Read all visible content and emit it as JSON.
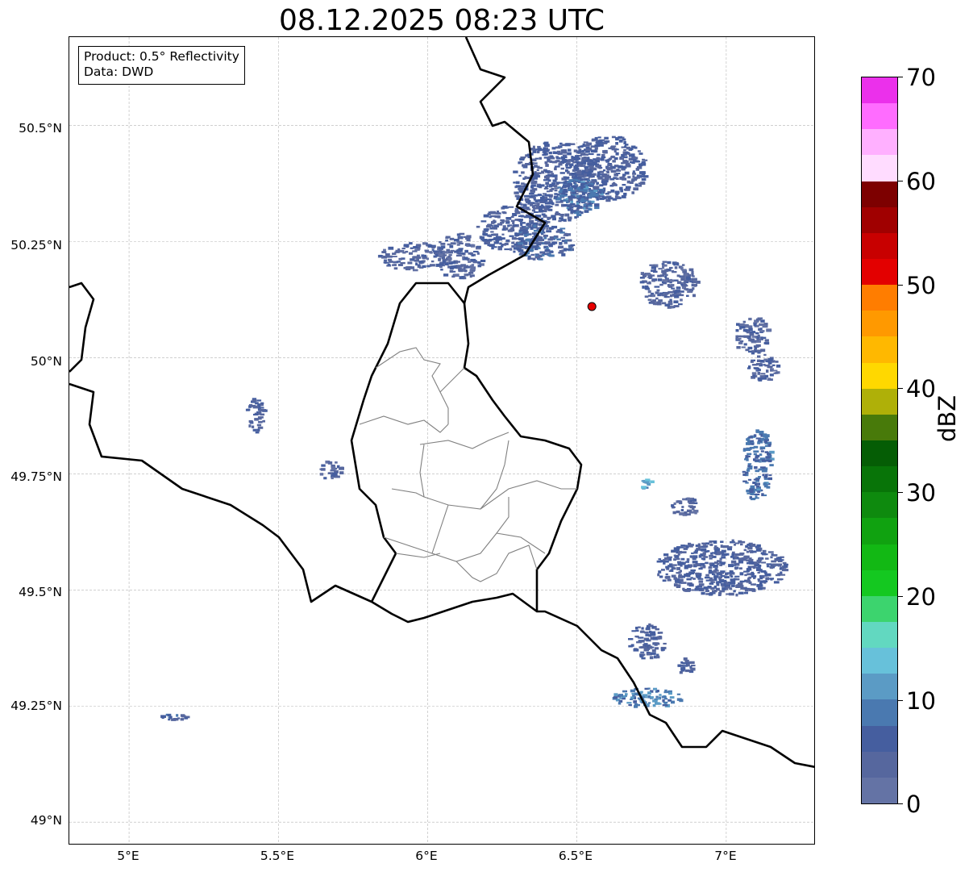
{
  "title": "08.12.2025 08:23 UTC",
  "info_box": {
    "product_line": "Product: 0.5° Reflectivity",
    "data_line": "Data: DWD"
  },
  "map": {
    "lon_range": [
      4.8,
      7.3
    ],
    "lat_range": [
      48.95,
      50.69
    ],
    "x_ticks": [
      "5°E",
      "5.5°E",
      "6°E",
      "6.5°E",
      "7°E"
    ],
    "y_ticks": [
      "50.5°N",
      "50.25°N",
      "50°N",
      "49.75°N",
      "49.5°N",
      "49.25°N",
      "49°N"
    ],
    "grid": true,
    "radar_site": {
      "lon": 6.55,
      "lat": 50.11,
      "color": "#e80000"
    },
    "border_color": "#000000",
    "district_color": "#808080"
  },
  "colorbar": {
    "label": "dBZ",
    "min": 0,
    "max": 70,
    "ticks": [
      "0",
      "10",
      "20",
      "30",
      "40",
      "50",
      "60",
      "70"
    ],
    "colors": [
      "#6473a5",
      "#56679e",
      "#455e9f",
      "#4a79b0",
      "#5b9bc5",
      "#67c1da",
      "#62d8c0",
      "#3cd46e",
      "#14c820",
      "#12b814",
      "#10a210",
      "#0e8a0e",
      "#087408",
      "#055d05",
      "#487a0a",
      "#afb008",
      "#ffd800",
      "#ffb800",
      "#ff9900",
      "#ff7d00",
      "#e30000",
      "#c80000",
      "#a00000",
      "#7d0000",
      "#ffdcff",
      "#ffb0ff",
      "#ff6cff",
      "#eb30eb"
    ]
  },
  "echoes": [
    {
      "lon": 6.42,
      "lat": 50.38,
      "rx": 0.14,
      "ry": 0.09,
      "dbz": 5
    },
    {
      "lon": 6.6,
      "lat": 50.41,
      "rx": 0.13,
      "ry": 0.07,
      "dbz": 5
    },
    {
      "lon": 6.28,
      "lat": 50.28,
      "rx": 0.12,
      "ry": 0.05,
      "dbz": 5
    },
    {
      "lon": 6.1,
      "lat": 50.22,
      "rx": 0.08,
      "ry": 0.05,
      "dbz": 4
    },
    {
      "lon": 5.95,
      "lat": 50.22,
      "rx": 0.12,
      "ry": 0.03,
      "dbz": 4
    },
    {
      "lon": 6.38,
      "lat": 50.25,
      "rx": 0.1,
      "ry": 0.04,
      "dbz": 6
    },
    {
      "lon": 6.5,
      "lat": 50.35,
      "rx": 0.08,
      "ry": 0.04,
      "dbz": 8
    },
    {
      "lon": 6.8,
      "lat": 50.16,
      "rx": 0.1,
      "ry": 0.05,
      "dbz": 4
    },
    {
      "lon": 7.08,
      "lat": 50.05,
      "rx": 0.06,
      "ry": 0.04,
      "dbz": 4
    },
    {
      "lon": 7.12,
      "lat": 49.98,
      "rx": 0.05,
      "ry": 0.03,
      "dbz": 4
    },
    {
      "lon": 7.1,
      "lat": 49.77,
      "rx": 0.05,
      "ry": 0.08,
      "dbz": 8
    },
    {
      "lon": 6.98,
      "lat": 49.55,
      "rx": 0.22,
      "ry": 0.06,
      "dbz": 5
    },
    {
      "lon": 6.86,
      "lat": 49.68,
      "rx": 0.05,
      "ry": 0.02,
      "dbz": 4
    },
    {
      "lon": 6.73,
      "lat": 49.27,
      "rx": 0.12,
      "ry": 0.02,
      "dbz": 9
    },
    {
      "lon": 6.73,
      "lat": 49.39,
      "rx": 0.06,
      "ry": 0.04,
      "dbz": 5
    },
    {
      "lon": 6.86,
      "lat": 49.34,
      "rx": 0.03,
      "ry": 0.02,
      "dbz": 5
    },
    {
      "lon": 5.42,
      "lat": 49.88,
      "rx": 0.03,
      "ry": 0.04,
      "dbz": 5
    },
    {
      "lon": 5.67,
      "lat": 49.76,
      "rx": 0.04,
      "ry": 0.02,
      "dbz": 4
    },
    {
      "lon": 5.15,
      "lat": 49.23,
      "rx": 0.05,
      "ry": 0.01,
      "dbz": 6
    },
    {
      "lon": 6.73,
      "lat": 49.73,
      "rx": 0.02,
      "ry": 0.01,
      "dbz": 12
    }
  ]
}
